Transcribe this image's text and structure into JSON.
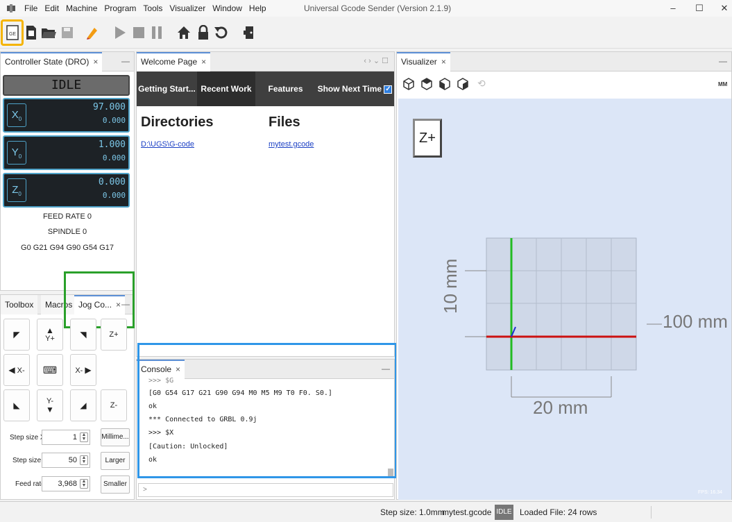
{
  "menu": {
    "items": [
      "File",
      "Edit",
      "Machine",
      "Program",
      "Tools",
      "Visualizer",
      "Window",
      "Help"
    ],
    "title": "Universal Gcode Sender (Version 2.1.9)"
  },
  "window_controls": {
    "minimize": "–",
    "maximize": "☐",
    "close": "✕"
  },
  "toolbar": {
    "buttons": [
      "connect-icon",
      "open-file-icon",
      "open-folder-icon",
      "save-icon",
      "edit-icon",
      "play-icon",
      "stop-icon",
      "pause-icon",
      "home-icon",
      "lock-icon",
      "reset-icon",
      "door-icon"
    ],
    "connect_label": "GE"
  },
  "dro": {
    "tab_label": "Controller State (DRO)",
    "state": "IDLE",
    "axes": [
      {
        "label": "X",
        "sub": "0",
        "work": "97.000",
        "machine": "0.000"
      },
      {
        "label": "Y",
        "sub": "0",
        "work": "1.000",
        "machine": "0.000"
      },
      {
        "label": "Z",
        "sub": "0",
        "work": "0.000",
        "machine": "0.000"
      }
    ],
    "feed_rate": "FEED RATE 0",
    "spindle": "SPINDLE 0",
    "gcode_state": "G0 G21 G94 G90 G54 G17"
  },
  "bottom_left_tabs": {
    "toolbox": "Toolbox",
    "macros": "Macros",
    "jog": "Jog Co...",
    "close": "×",
    "minimize": "—"
  },
  "jog": {
    "yplus": "Y+",
    "yminus": "Y-",
    "xminus": "X-",
    "xplus": "X-",
    "zplus": "Z+",
    "zminus": "Z-",
    "step_xy_label": "Step size XY",
    "step_xy_value": "1",
    "step_z_label": "Step size Z",
    "step_z_value": "50",
    "feed_label": "Feed rate",
    "feed_value": "3,968",
    "unit_button": "Millime...",
    "larger_button": "Larger",
    "smaller_button": "Smaller"
  },
  "welcome": {
    "tab_label": "Welcome Page",
    "tabs": [
      "Getting Start...",
      "Recent Work",
      "Features"
    ],
    "show_next_time": "Show Next Time",
    "directories_heading": "Directories",
    "files_heading": "Files",
    "directory_link": "D:\\UGS\\G-code",
    "file_link": "mytest.gcode"
  },
  "console": {
    "tab_label": "Console",
    "lines": [
      ">>> $G",
      "[G0 G54 G17 G21 G90 G94 M0 M5 M9 T0 F0. S0.]",
      "ok",
      "*** Connected to GRBL 0.9j",
      ">>> $X",
      "[Caution: Unlocked]",
      "ok"
    ],
    "prompt": ">"
  },
  "visualizer": {
    "tab_label": "Visualizer",
    "units_label": "MM",
    "z_button": "Z+",
    "dim_y": "10 mm",
    "dim_x": "100 mm",
    "dim_bottom": "20 mm",
    "fps": "FPS: 16.34"
  },
  "status": {
    "step_size": "Step size: 1.0mm",
    "file": "mytest.gcode",
    "state": "IDLE",
    "loaded": "Loaded File: 24 rows"
  },
  "colors": {
    "highlight_yellow": "#f5b400",
    "highlight_green": "#2aa02a",
    "highlight_blue": "#2f96e8",
    "dro_border": "#4fa3c9",
    "viz_bg": "#dce6f7"
  }
}
